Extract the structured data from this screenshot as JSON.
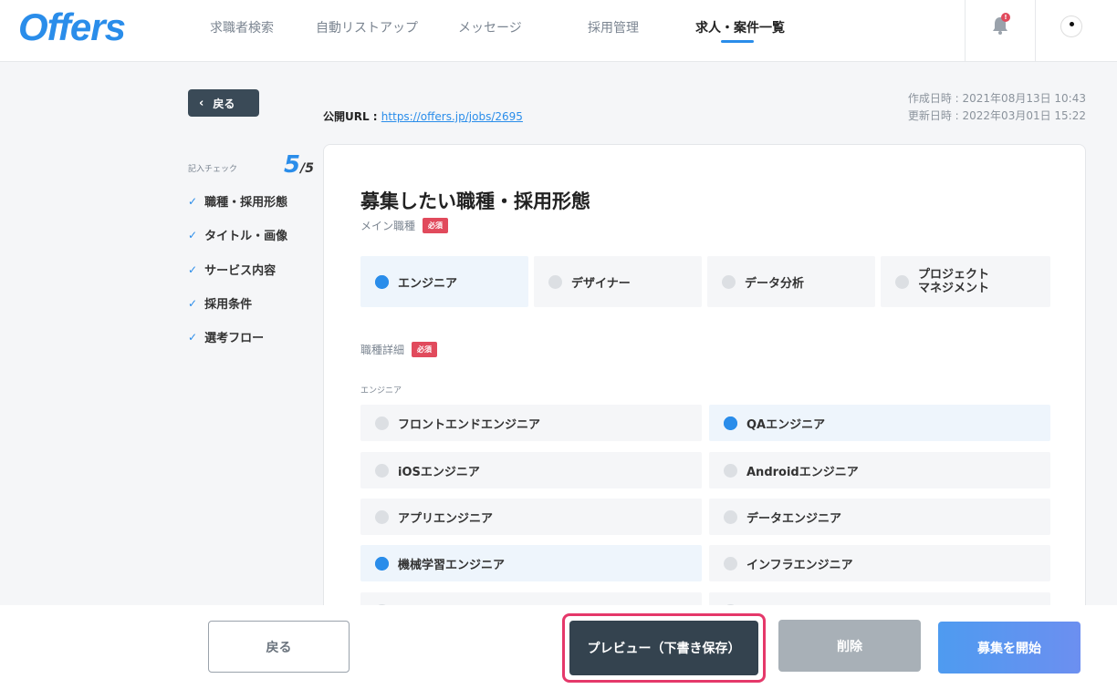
{
  "header": {
    "logo": "Offers",
    "nav": [
      "求職者検索",
      "自動リストアップ",
      "メッセージ",
      "採用管理",
      "求人・案件一覧"
    ],
    "notification_badge": "!"
  },
  "top": {
    "back_label": "戻る",
    "public_url_label": "公開URL : ",
    "public_url": "https://offers.jp/jobs/2695",
    "created": "作成日時 : 2021年08月13日 10:43",
    "updated": "更新日時 : 2022年03月01日 15:22"
  },
  "sidebar": {
    "check_label": "記入チェック",
    "check_done": "5",
    "check_total": "/5",
    "items": [
      "職種・採用形態",
      "タイトル・画像",
      "サービス内容",
      "採用条件",
      "選考フロー"
    ]
  },
  "form": {
    "section_title": "募集したい職種・採用形態",
    "main_label": "メイン職種",
    "required_label": "必須",
    "main_options": [
      "エンジニア",
      "デザイナー",
      "データ分析",
      "プロジェクト",
      "マネジメント"
    ],
    "detail_label": "職種詳細",
    "engineer_label": "エンジニア",
    "detail_options": [
      "フロントエンドエンジニア",
      "QAエンジニア",
      "iOSエンジニア",
      "Androidエンジニア",
      "アプリエンジニア",
      "データエンジニア",
      "機械学習エンジニア",
      "インフラエンジニア"
    ]
  },
  "footer": {
    "back": "戻る",
    "preview": "プレビュー（下書き保存）",
    "delete": "削除",
    "start": "募集を開始"
  },
  "colors": {
    "accent": "#2a8dea",
    "required": "#e14a5c",
    "highlight_ring": "#e5386a"
  }
}
